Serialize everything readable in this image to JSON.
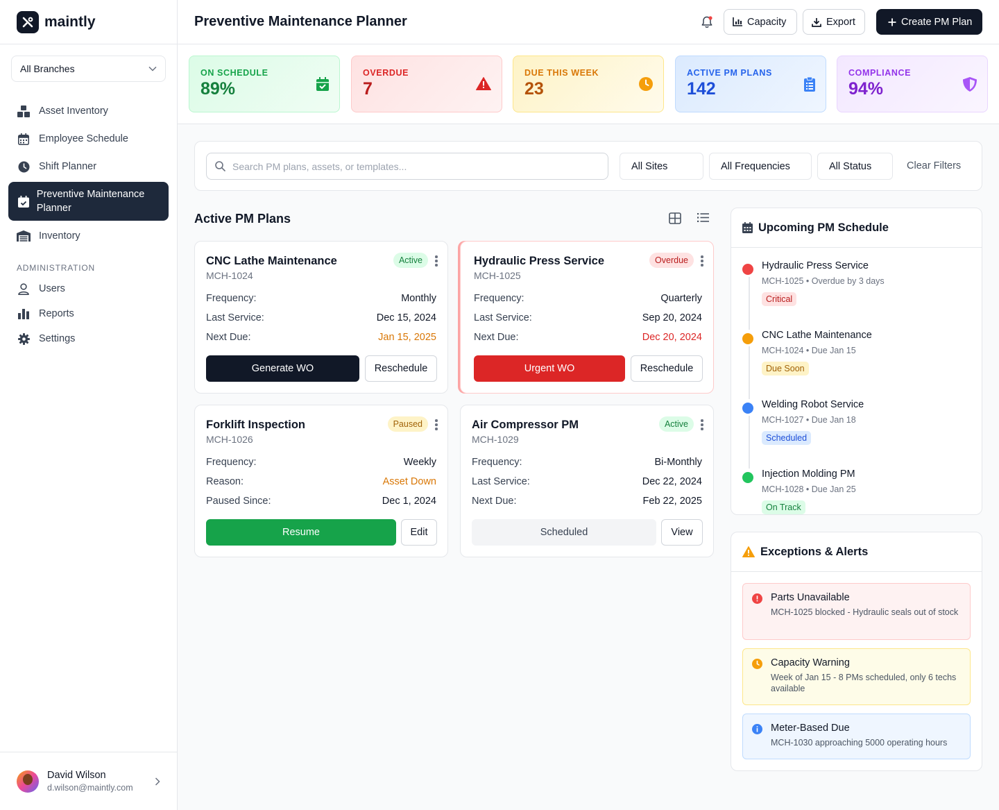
{
  "app": {
    "name": "maintly"
  },
  "sidebar": {
    "branch_select": "All Branches",
    "items": [
      {
        "label": "Asset Inventory",
        "icon": "cubes-icon"
      },
      {
        "label": "Employee Schedule",
        "icon": "calendar-icon"
      },
      {
        "label": "Shift Planner",
        "icon": "clock-icon"
      },
      {
        "label": "Preventive Maintenance Planner",
        "icon": "calendar-check-icon",
        "active": true
      },
      {
        "label": "Inventory",
        "icon": "warehouse-icon"
      }
    ],
    "admin_section": "ADMINISTRATION",
    "admin_items": [
      {
        "label": "Users",
        "icon": "user-icon"
      },
      {
        "label": "Reports",
        "icon": "chart-bar-icon"
      },
      {
        "label": "Settings",
        "icon": "gear-icon"
      }
    ],
    "user": {
      "name": "David Wilson",
      "email": "d.wilson@maintly.com"
    }
  },
  "header": {
    "title": "Preventive Maintenance Planner",
    "capacity_label": "Capacity",
    "export_label": "Export",
    "create_label": "Create PM Plan"
  },
  "stats": [
    {
      "label": "ON SCHEDULE",
      "value": "89%",
      "icon": "calendar-check-icon",
      "color": "#16a34a"
    },
    {
      "label": "OVERDUE",
      "value": "7",
      "icon": "warning-icon",
      "color": "#dc2626"
    },
    {
      "label": "DUE THIS WEEK",
      "value": "23",
      "icon": "clock-icon",
      "color": "#d97706"
    },
    {
      "label": "ACTIVE PM PLANS",
      "value": "142",
      "icon": "clipboard-icon",
      "color": "#2563eb"
    },
    {
      "label": "COMPLIANCE",
      "value": "94%",
      "icon": "shield-icon",
      "color": "#9333ea"
    }
  ],
  "filters": {
    "search_placeholder": "Search PM plans, assets, or templates...",
    "site": "All Sites",
    "frequency": "All Frequencies",
    "status": "All Status",
    "clear_label": "Clear Filters"
  },
  "plans_section": {
    "title": "Active PM Plans"
  },
  "plans": [
    {
      "title": "CNC Lathe Maintenance",
      "id": "MCH-1024",
      "status": "Active",
      "rows": [
        {
          "k": "Frequency:",
          "v": "Monthly"
        },
        {
          "k": "Last Service:",
          "v": "Dec 15, 2024"
        },
        {
          "k": "Next Due:",
          "v": "Jan 15, 2025"
        }
      ],
      "primary": "Generate WO",
      "secondary": "Reschedule"
    },
    {
      "title": "Hydraulic Press Service",
      "id": "MCH-1025",
      "status": "Overdue",
      "rows": [
        {
          "k": "Frequency:",
          "v": "Quarterly"
        },
        {
          "k": "Last Service:",
          "v": "Sep 20, 2024"
        },
        {
          "k": "Next Due:",
          "v": "Dec 20, 2024"
        }
      ],
      "primary": "Urgent WO",
      "secondary": "Reschedule"
    },
    {
      "title": "Forklift Inspection",
      "id": "MCH-1026",
      "status": "Paused",
      "rows": [
        {
          "k": "Frequency:",
          "v": "Weekly"
        },
        {
          "k": "Reason:",
          "v": "Asset Down"
        },
        {
          "k": "Paused Since:",
          "v": "Dec 1, 2024"
        }
      ],
      "primary": "Resume",
      "secondary": "Edit"
    },
    {
      "title": "Air Compressor PM",
      "id": "MCH-1029",
      "status": "Active",
      "rows": [
        {
          "k": "Frequency:",
          "v": "Bi-Monthly"
        },
        {
          "k": "Last Service:",
          "v": "Dec 22, 2024"
        },
        {
          "k": "Next Due:",
          "v": "Feb 22, 2025"
        }
      ],
      "primary": "Scheduled",
      "secondary": "View"
    }
  ],
  "schedule": {
    "title": "Upcoming PM Schedule",
    "items": [
      {
        "title": "Hydraulic Press Service",
        "desc": "MCH-1025 • Overdue by 3 days",
        "tag": "Critical",
        "color": "#ef4444"
      },
      {
        "title": "CNC Lathe Maintenance",
        "desc": "MCH-1024 • Due Jan 15",
        "tag": "Due Soon",
        "color": "#f59e0b"
      },
      {
        "title": "Welding Robot Service",
        "desc": "MCH-1027 • Due Jan 18",
        "tag": "Scheduled",
        "color": "#3b82f6"
      },
      {
        "title": "Injection Molding PM",
        "desc": "MCH-1028 • Due Jan 25",
        "tag": "On Track",
        "color": "#22c55e"
      }
    ]
  },
  "alerts": {
    "title": "Exceptions & Alerts",
    "items": [
      {
        "title": "Parts Unavailable",
        "desc": "MCH-1025 blocked - Hydraulic seals out of stock",
        "icon": "error-icon"
      },
      {
        "title": "Capacity Warning",
        "desc": "Week of Jan 15 - 8 PMs scheduled, only 6 techs available",
        "icon": "clock-icon"
      },
      {
        "title": "Meter-Based Due",
        "desc": "MCH-1030 approaching 5000 operating hours",
        "icon": "info-icon"
      }
    ]
  }
}
